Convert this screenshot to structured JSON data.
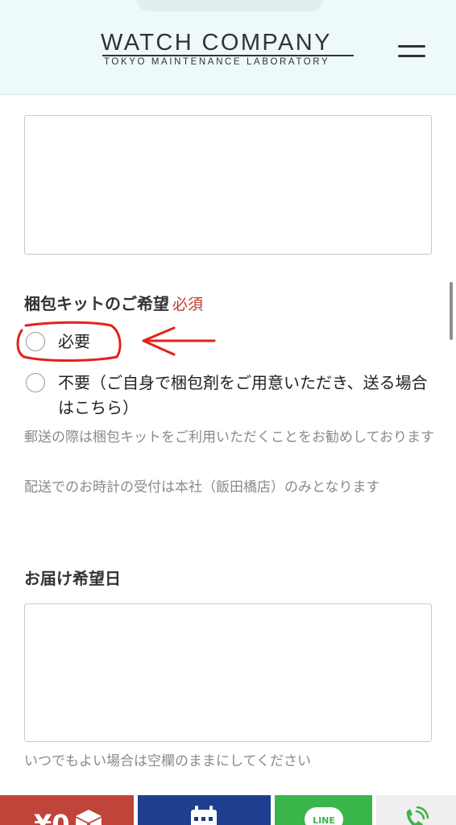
{
  "header": {
    "logo_main": "WATCH COMPANY",
    "logo_sub": "TOKYO MAINTENANCE LABORATORY"
  },
  "form": {
    "packing_kit": {
      "label": "梱包キットのご希望",
      "required": "必須",
      "options": [
        {
          "label": "必要",
          "selected": false
        },
        {
          "label": "不要（ご自身で梱包剤をご用意いただき、送る場合はこちら）",
          "selected": false
        }
      ],
      "note_1": "郵送の際は梱包キットをご利用いただくことをお勧めしております",
      "note_2": "配送でのお時計の受付は本社（飯田橋店）のみとなります"
    },
    "delivery_date": {
      "label": "お届け希望日",
      "value": "",
      "note": "いつでもよい場合は空欄のままにしてください"
    },
    "previous_field": {
      "value": ""
    }
  },
  "bottom_bar": {
    "estimate_label": "¥0",
    "line_label": "LINE"
  },
  "colors": {
    "header_bg": "#eef9fb",
    "required_red": "#c0392b",
    "annotation_red": "#e2231a",
    "bar_red": "#c0443a",
    "bar_blue": "#1e3f8f",
    "bar_green": "#3ab54a"
  },
  "icons": {
    "menu": "hamburger-icon",
    "estimate": "box-icon",
    "reserve": "calendar-icon",
    "phone": "phone-icon"
  }
}
